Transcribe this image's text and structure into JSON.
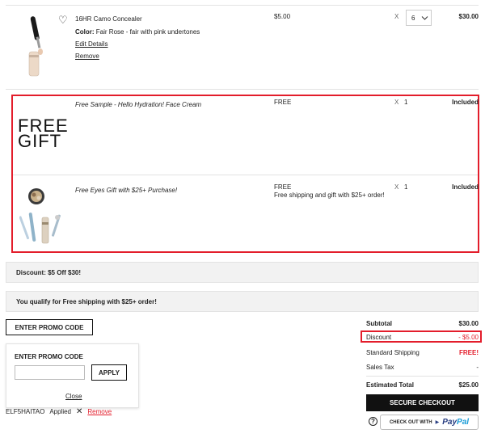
{
  "items": [
    {
      "name": "16HR Camo Concealer",
      "color_label": "Color:",
      "color_value": "Fair Rose - fair with pink undertones",
      "edit_label": "Edit Details",
      "remove_label": "Remove",
      "price": "$5.00",
      "qty_x": "X",
      "qty_value": "6",
      "total": "$30.00"
    },
    {
      "image_text_line1": "FREE",
      "image_text_line2": "GIFT",
      "name": "Free Sample - Hello Hydration! Face Cream",
      "price": "FREE",
      "qty_x": "X",
      "qty_value": "1",
      "total": "Included"
    },
    {
      "name": "Free Eyes Gift with $25+ Purchase!",
      "price": "FREE",
      "price_note": "Free shipping and gift with $25+ order!",
      "qty_x": "X",
      "qty_value": "1",
      "total": "Included"
    }
  ],
  "banners": {
    "discount": "Discount: $5 Off $30!",
    "shipping": "You qualify for Free shipping with $25+ order!"
  },
  "promo": {
    "toggle_label": "ENTER PROMO CODE",
    "panel_title": "ENTER PROMO CODE",
    "input_value": "",
    "apply_label": "APPLY",
    "close_label": "Close",
    "applied_code": "ELF5HAITAO",
    "applied_status": "Applied",
    "remove_label": "Remove"
  },
  "summary": {
    "subtotal_label": "Subtotal",
    "subtotal_value": "$30.00",
    "discount_label": "Discount",
    "discount_value": "- $5.00",
    "shipping_label": "Standard Shipping",
    "shipping_value": "FREE!",
    "tax_label": "Sales Tax",
    "tax_value": "-",
    "total_label": "Estimated Total",
    "total_value": "$25.00",
    "checkout_label": "SECURE CHECKOUT",
    "paypal_prefix": "CHECK OUT WITH",
    "paypal_brand_pay": "Pay",
    "paypal_brand_pal": "Pal"
  },
  "colors": {
    "highlight": "#e31d2b",
    "free_shipping": "#e31d2b",
    "paypal_dark": "#253b80",
    "paypal_light": "#179bd7"
  }
}
